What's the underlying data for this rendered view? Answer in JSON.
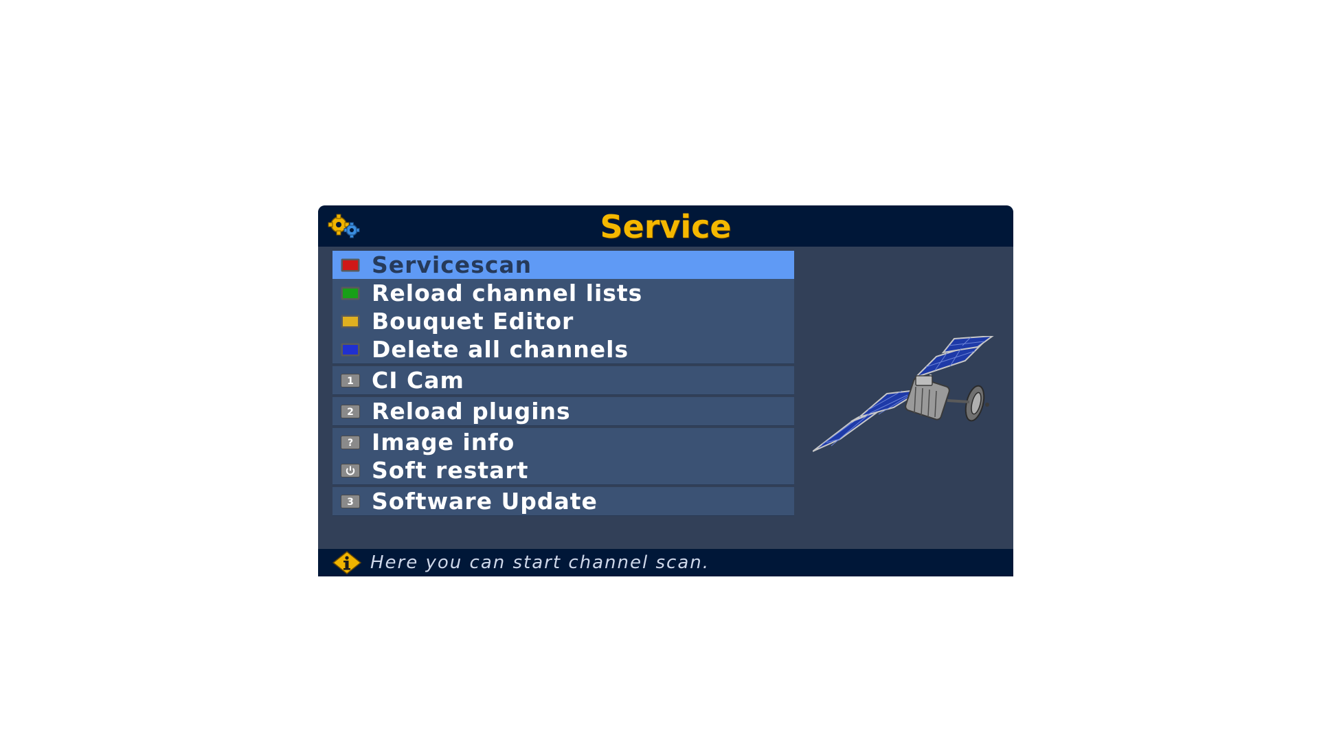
{
  "window": {
    "title": "Service",
    "title_icon": "gears-icon",
    "title_color": "#f5b800"
  },
  "menu": {
    "groups": [
      {
        "items": [
          {
            "key": "red-button-icon",
            "label": "Servicescan",
            "selected": true
          },
          {
            "key": "green-button-icon",
            "label": "Reload channel lists"
          },
          {
            "key": "yellow-button-icon",
            "label": "Bouquet Editor"
          },
          {
            "key": "blue-button-icon",
            "label": "Delete all channels"
          }
        ]
      },
      {
        "items": [
          {
            "key": "key-1-icon",
            "key_label": "1",
            "label": "CI Cam"
          }
        ]
      },
      {
        "items": [
          {
            "key": "key-2-icon",
            "key_label": "2",
            "label": "Reload plugins"
          }
        ]
      },
      {
        "items": [
          {
            "key": "help-key-icon",
            "key_label": "?",
            "label": "Image info"
          },
          {
            "key": "power-key-icon",
            "label": "Soft restart"
          }
        ]
      },
      {
        "items": [
          {
            "key": "key-3-icon",
            "key_label": "3",
            "label": "Software Update"
          }
        ]
      }
    ]
  },
  "hint": {
    "icon": "info-icon",
    "text": "Here you can start channel scan."
  },
  "colors": {
    "background": "#324058",
    "title_bar": "#001738",
    "menu_group": "#3b5274",
    "selection": "#5f9af5",
    "red_key": "#d01818",
    "green_key": "#18a018",
    "yellow_key": "#e0b020",
    "blue_key": "#2030d0"
  },
  "decoration": {
    "image": "satellite-illustration"
  }
}
